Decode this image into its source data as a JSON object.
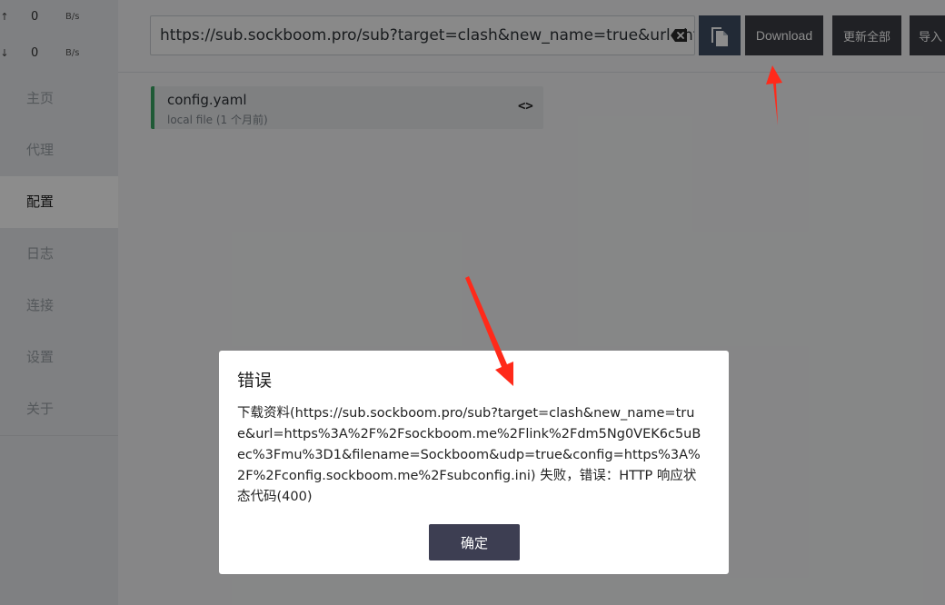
{
  "traffic": {
    "up": {
      "arrow": "↑",
      "value": "0",
      "unit": "B/s"
    },
    "down": {
      "arrow": "↓",
      "value": "0",
      "unit": "B/s"
    }
  },
  "sidebar": {
    "items": [
      {
        "label": "主页"
      },
      {
        "label": "代理"
      },
      {
        "label": "配置"
      },
      {
        "label": "日志"
      },
      {
        "label": "连接"
      },
      {
        "label": "设置"
      },
      {
        "label": "关于"
      }
    ],
    "active_index": 2
  },
  "toolbar": {
    "url_value": "https://sub.sockboom.pro/sub?target=clash&new_name=true&url=http",
    "download_label": "Download",
    "update_all_label": "更新全部",
    "import_label": "导入"
  },
  "profile": {
    "name": "config.yaml",
    "subtitle": "local file (1 个月前)",
    "status_color": "#3aa563"
  },
  "dialog": {
    "title": "错误",
    "message": "下载资料(https://sub.sockboom.pro/sub?target=clash&new_name=true&url=https%3A%2F%2Fsockboom.me%2Flink%2Fdm5Ng0VEK6c5uBec%3Fmu%3D1&filename=Sockboom&udp=true&config=https%3A%2F%2Fconfig.sockboom.me%2Fsubconfig.ini) 失败，错误：HTTP 响应状态代码(400)",
    "ok_label": "确定"
  },
  "icons": {
    "clear": "backspace-icon",
    "copy": "copy-icon",
    "code": "code-icon"
  },
  "colors": {
    "accent_dark": "#3b3d44",
    "annotation_arrow": "#ff2a1a"
  }
}
